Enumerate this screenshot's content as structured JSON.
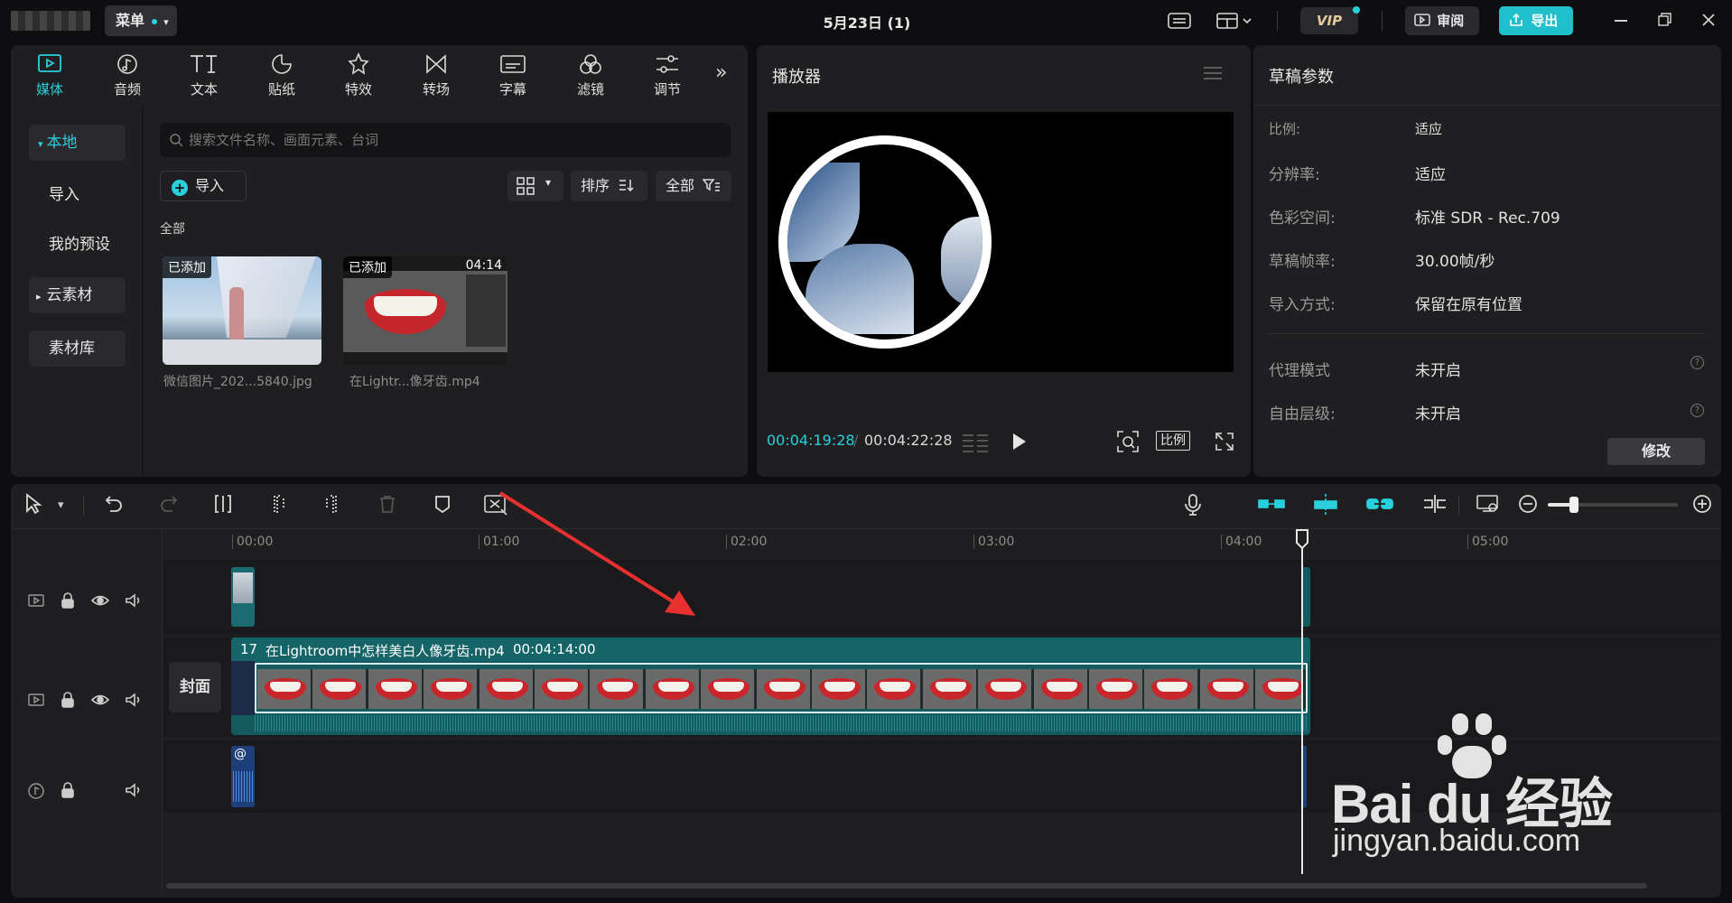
{
  "topbar": {
    "menu_label": "菜单",
    "title": "5月23日 (1)",
    "vip_label": "VIP",
    "review_label": "审阅",
    "export_label": "导出"
  },
  "toolbar": {
    "tabs": [
      {
        "label": "媒体",
        "icon": "media-icon",
        "active": true
      },
      {
        "label": "音频",
        "icon": "audio-icon"
      },
      {
        "label": "文本",
        "icon": "text-icon"
      },
      {
        "label": "贴纸",
        "icon": "sticker-icon"
      },
      {
        "label": "特效",
        "icon": "effects-icon"
      },
      {
        "label": "转场",
        "icon": "transition-icon"
      },
      {
        "label": "字幕",
        "icon": "subtitle-icon"
      },
      {
        "label": "滤镜",
        "icon": "filter-icon"
      },
      {
        "label": "调节",
        "icon": "adjust-icon"
      }
    ],
    "more_glyph": "»"
  },
  "sidebar": {
    "items": [
      {
        "label": "本地",
        "active": true,
        "caret": "▾"
      },
      {
        "label": "导入"
      },
      {
        "label": "我的预设"
      },
      {
        "label": "云素材",
        "caret": "▸"
      },
      {
        "label": "素材库"
      }
    ]
  },
  "media": {
    "search_placeholder": "搜索文件名称、画面元素、台词",
    "import_label": "导入",
    "sort_label": "排序",
    "filter_label": "全部",
    "section_label": "全部",
    "items": [
      {
        "badge": "已添加",
        "name": "微信图片_202...5840.jpg",
        "duration": ""
      },
      {
        "badge": "已添加",
        "name": "在Lightr...像牙齿.mp4",
        "duration": "04:14"
      }
    ]
  },
  "player": {
    "title": "播放器",
    "current_time": "00:04:19:28",
    "total_time": "00:04:22:28",
    "ratio_label": "比例"
  },
  "draft": {
    "title": "草稿参数",
    "rows": [
      {
        "label": "比例:",
        "value": "适应"
      },
      {
        "label": "分辨率:",
        "value": "适应"
      },
      {
        "label": "色彩空间:",
        "value": "标准 SDR - Rec.709"
      },
      {
        "label": "草稿帧率:",
        "value": "30.00帧/秒"
      },
      {
        "label": "导入方式:",
        "value": "保留在原有位置"
      },
      {
        "label": "代理模式",
        "value": "未开启"
      },
      {
        "label": "自由层级:",
        "value": "未开启"
      }
    ],
    "modify_label": "修改"
  },
  "timeline": {
    "ruler": [
      "00:00",
      "01:00",
      "02:00",
      "03:00",
      "04:00",
      "05:00"
    ],
    "cover_label": "封面",
    "clip_index": "17",
    "clip_name": "在Lightroom中怎样美白人像牙齿.mp4",
    "clip_duration": "00:04:14:00",
    "audio_clip_label": "@"
  },
  "watermark": {
    "brand": "Bai du 经验",
    "url": "jingyan.baidu.com"
  }
}
